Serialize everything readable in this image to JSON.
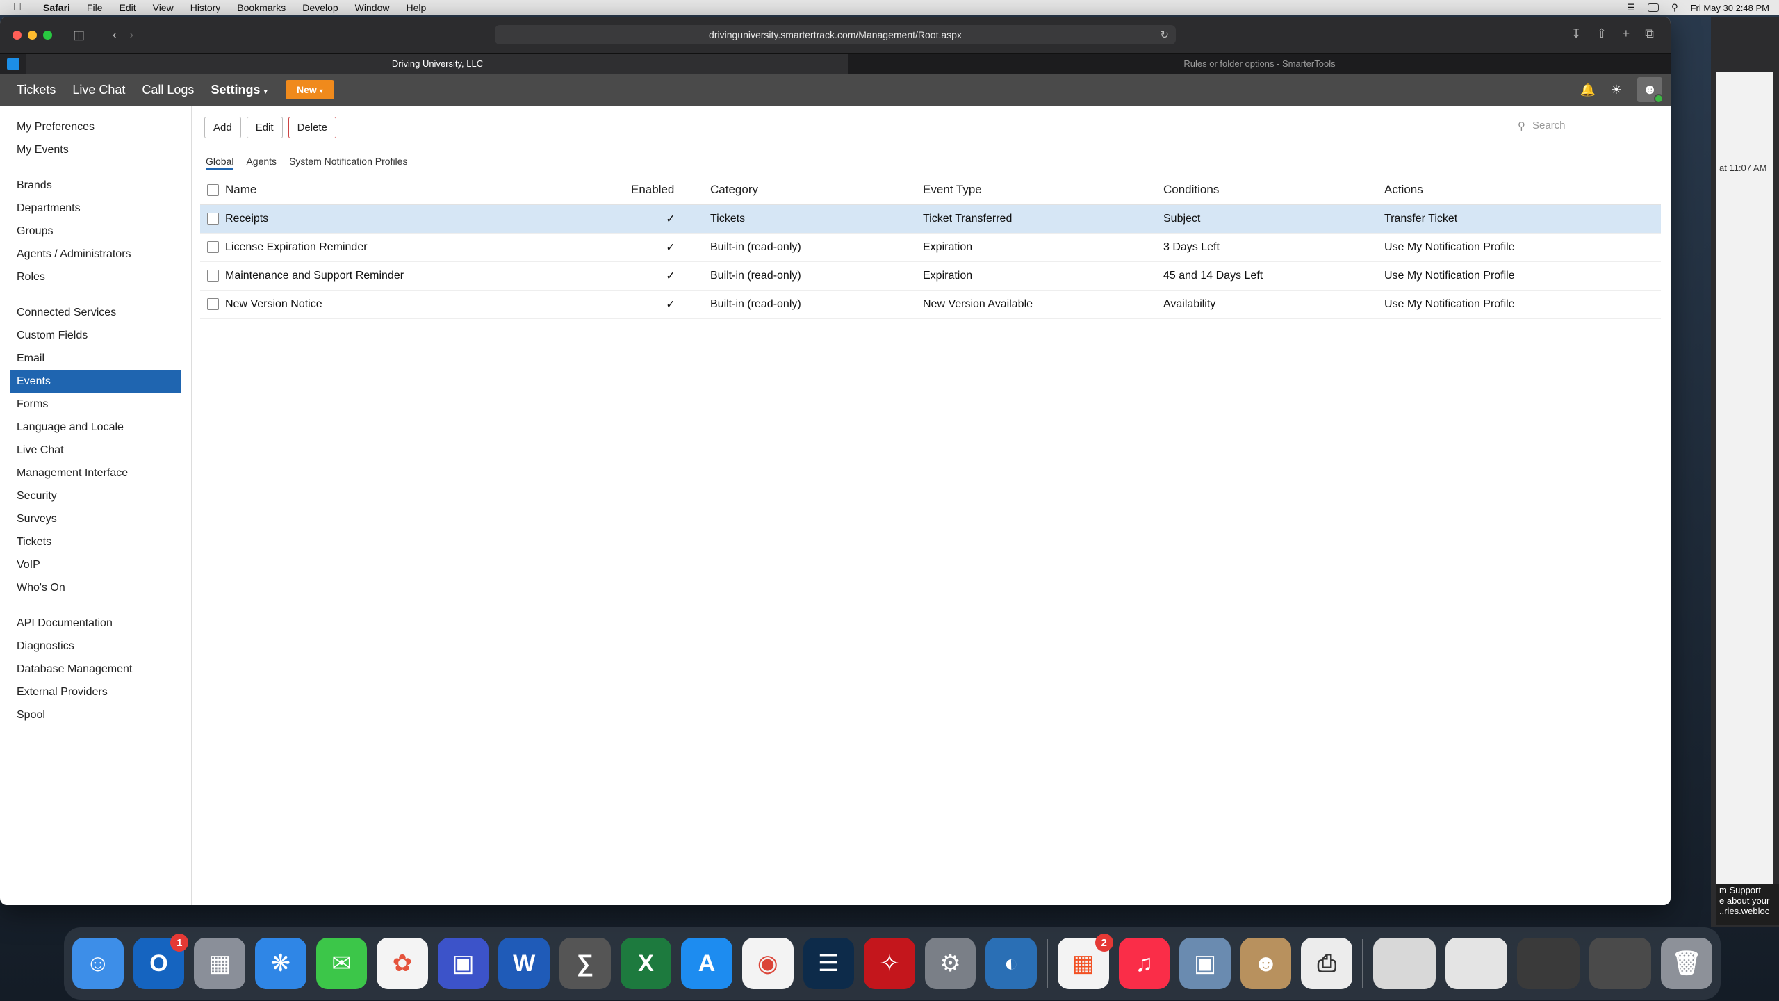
{
  "menubar": {
    "app": "Safari",
    "items": [
      "File",
      "Edit",
      "View",
      "History",
      "Bookmarks",
      "Develop",
      "Window",
      "Help"
    ],
    "datetime": "Fri May 30  2:48 PM"
  },
  "browser": {
    "url": "drivinguniversity.smartertrack.com/Management/Root.aspx",
    "tabs": [
      {
        "label": "Driving University, LLC"
      },
      {
        "label": "Rules or folder options - SmarterTools"
      }
    ]
  },
  "appnav": {
    "links": [
      "Tickets",
      "Live Chat",
      "Call Logs"
    ],
    "settings_label": "Settings",
    "new_label": "New"
  },
  "sidebar": {
    "group1": [
      "My Preferences",
      "My Events"
    ],
    "group2": [
      "Brands",
      "Departments",
      "Groups",
      "Agents / Administrators",
      "Roles"
    ],
    "group3": [
      "Connected Services",
      "Custom Fields",
      "Email",
      "Events",
      "Forms",
      "Language and Locale",
      "Live Chat",
      "Management Interface",
      "Security",
      "Surveys",
      "Tickets",
      "VoIP",
      "Who's On"
    ],
    "group4": [
      "API Documentation",
      "Diagnostics",
      "Database Management",
      "External Providers",
      "Spool"
    ],
    "active": "Events"
  },
  "toolbar": {
    "add": "Add",
    "edit": "Edit",
    "delete": "Delete",
    "search_placeholder": "Search"
  },
  "subtabs": [
    "Global",
    "Agents",
    "System Notification Profiles"
  ],
  "table": {
    "headers": [
      "Name",
      "Enabled",
      "Category",
      "Event Type",
      "Conditions",
      "Actions"
    ],
    "rows": [
      {
        "name": "Receipts",
        "enabled": "✓",
        "category": "Tickets",
        "event_type": "Ticket Transferred",
        "conditions": "Subject",
        "actions": "Transfer Ticket"
      },
      {
        "name": "License Expiration Reminder",
        "enabled": "✓",
        "category": "Built-in (read-only)",
        "event_type": "Expiration",
        "conditions": "3 Days Left",
        "actions": "Use My Notification Profile"
      },
      {
        "name": "Maintenance and Support Reminder",
        "enabled": "✓",
        "category": "Built-in (read-only)",
        "event_type": "Expiration",
        "conditions": "45 and 14 Days Left",
        "actions": "Use My Notification Profile"
      },
      {
        "name": "New Version Notice",
        "enabled": "✓",
        "category": "Built-in (read-only)",
        "event_type": "New Version Available",
        "conditions": "Availability",
        "actions": "Use My Notification Profile"
      }
    ]
  },
  "background_window": {
    "time": "at 11:07 AM",
    "support_text": "m Support",
    "support_text2": "e about your",
    "support_text3": "..ries.webloc"
  },
  "dock": {
    "outlook_badge": "1",
    "office_badge": "2"
  },
  "colors": {
    "accent": "#1f65b0",
    "new_button": "#f08a1c",
    "navbar": "#4a4a4a",
    "selected_row": "#d6e6f5"
  }
}
